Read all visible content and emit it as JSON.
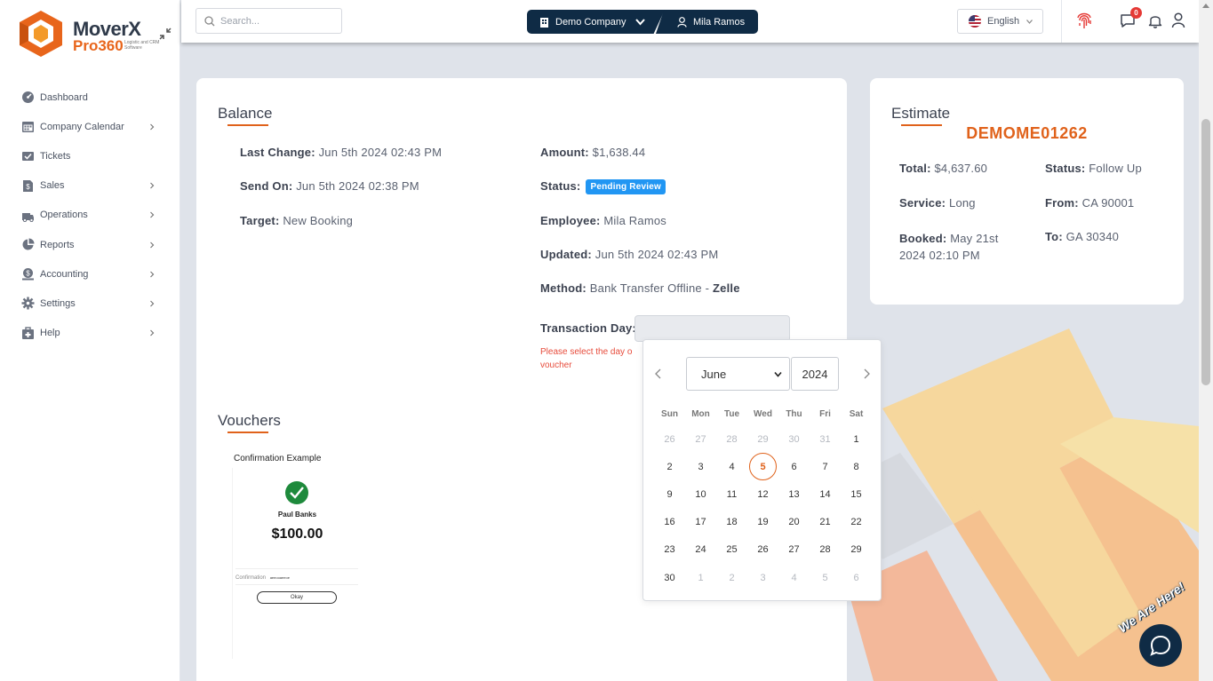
{
  "app": {
    "logo_title": "MoverX",
    "logo_sub": "Pro360",
    "logo_tag": "Logistic and CRM Software"
  },
  "sidebar": {
    "items": [
      {
        "label": "Dashboard",
        "icon": "dashboard-icon",
        "has_children": false
      },
      {
        "label": "Company Calendar",
        "icon": "calendar-icon",
        "has_children": true
      },
      {
        "label": "Tickets",
        "icon": "tickets-icon",
        "has_children": false
      },
      {
        "label": "Sales",
        "icon": "sales-icon",
        "has_children": true
      },
      {
        "label": "Operations",
        "icon": "operations-icon",
        "has_children": true
      },
      {
        "label": "Reports",
        "icon": "reports-icon",
        "has_children": true
      },
      {
        "label": "Accounting",
        "icon": "accounting-icon",
        "has_children": true
      },
      {
        "label": "Settings",
        "icon": "settings-icon",
        "has_children": true
      },
      {
        "label": "Help",
        "icon": "help-icon",
        "has_children": true
      }
    ]
  },
  "topbar": {
    "search_placeholder": "Search...",
    "company": "Demo Company",
    "user": "Mila Ramos",
    "language": "English",
    "notification_count": "0"
  },
  "balance": {
    "title": "Balance",
    "last_change_label": "Last Change:",
    "last_change_value": "Jun 5th 2024 02:43 PM",
    "send_on_label": "Send On:",
    "send_on_value": "Jun 5th 2024 02:38 PM",
    "target_label": "Target:",
    "target_value": "New Booking",
    "amount_label": "Amount:",
    "amount_value": "$1,638.44",
    "status_label": "Status:",
    "status_value": "Pending Review",
    "employee_label": "Employee:",
    "employee_value": "Mila Ramos",
    "updated_label": "Updated:",
    "updated_value": "Jun 5th 2024 02:43 PM",
    "method_label": "Method:",
    "method_value": "Bank Transfer Offline - ",
    "method_provider": "Zelle",
    "transaction_day_label": "Transaction Day:",
    "error_text": "Please select the day o",
    "error_text_2": "voucher"
  },
  "vouchers": {
    "title": "Vouchers",
    "item": {
      "heading": "Confirmation Example",
      "name": "Paul Banks",
      "amount": "$100.00",
      "confirmation_label": "Confirmation",
      "confirmation_value": "aeeooaeeoe",
      "button": "Okay"
    }
  },
  "estimate": {
    "title": "Estimate",
    "code": "DEMOME01262",
    "total_label": "Total:",
    "total_value": "$4,637.60",
    "status_label": "Status:",
    "status_value": "Follow Up",
    "service_label": "Service:",
    "service_value": "Long",
    "from_label": "From:",
    "from_value": "CA 90001",
    "booked_label": "Booked:",
    "booked_value_1": "May 21st",
    "booked_value_2": "2024 02:10 PM",
    "to_label": "To:",
    "to_value": "GA 30340"
  },
  "datepicker": {
    "month": "June",
    "year": "2024",
    "weekdays": [
      "Sun",
      "Mon",
      "Tue",
      "Wed",
      "Thu",
      "Fri",
      "Sat"
    ],
    "weeks": [
      [
        {
          "d": "26",
          "m": true
        },
        {
          "d": "27",
          "m": true
        },
        {
          "d": "28",
          "m": true
        },
        {
          "d": "29",
          "m": true
        },
        {
          "d": "30",
          "m": true
        },
        {
          "d": "31",
          "m": true
        },
        {
          "d": "1"
        }
      ],
      [
        {
          "d": "2"
        },
        {
          "d": "3"
        },
        {
          "d": "4"
        },
        {
          "d": "5",
          "today": true
        },
        {
          "d": "6"
        },
        {
          "d": "7"
        },
        {
          "d": "8"
        }
      ],
      [
        {
          "d": "9"
        },
        {
          "d": "10"
        },
        {
          "d": "11"
        },
        {
          "d": "12"
        },
        {
          "d": "13"
        },
        {
          "d": "14"
        },
        {
          "d": "15"
        }
      ],
      [
        {
          "d": "16"
        },
        {
          "d": "17"
        },
        {
          "d": "18"
        },
        {
          "d": "19"
        },
        {
          "d": "20"
        },
        {
          "d": "21"
        },
        {
          "d": "22"
        }
      ],
      [
        {
          "d": "23"
        },
        {
          "d": "24"
        },
        {
          "d": "25"
        },
        {
          "d": "26"
        },
        {
          "d": "27"
        },
        {
          "d": "28"
        },
        {
          "d": "29"
        }
      ],
      [
        {
          "d": "30"
        },
        {
          "d": "1",
          "m": true
        },
        {
          "d": "2",
          "m": true
        },
        {
          "d": "3",
          "m": true
        },
        {
          "d": "4",
          "m": true
        },
        {
          "d": "5",
          "m": true
        },
        {
          "d": "6",
          "m": true
        }
      ]
    ]
  },
  "chat": {
    "label": "We Are Here!"
  },
  "colors": {
    "accent": "#e0621b",
    "navy": "#0f2b45",
    "status_blue": "#2196f3",
    "error": "#e74c3c"
  }
}
